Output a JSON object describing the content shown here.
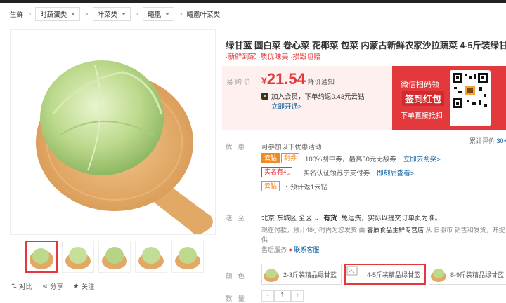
{
  "breadcrumb": {
    "items": [
      {
        "label": "生鲜",
        "type": "text"
      },
      {
        "label": "时蔬蛋类",
        "type": "select"
      },
      {
        "label": "叶菜类",
        "type": "select"
      },
      {
        "label": "曦凰",
        "type": "select"
      },
      {
        "label": "曦凰叶菜类",
        "type": "text"
      }
    ]
  },
  "image_actions": {
    "compare": "对比",
    "share": "分享",
    "follow": "关注"
  },
  "product": {
    "title": "绿甘蓝 圆白菜 卷心菜 花椰菜 包菜 内蒙古新鲜农家沙拉蔬菜 4-5斤装绿甘蓝",
    "subtitle": "·新鲜到家 ·质优味美 ·损毁包赔"
  },
  "price": {
    "label": "易购价",
    "yen": "¥",
    "value": "21.54",
    "notify": "降价通知",
    "member_text": "加入会员，下单约返0.43元云钻",
    "member_link": "立即开通>"
  },
  "promo_banner": {
    "line1": "微信扫码领",
    "line2": "签到红包",
    "line3": "下单直接抵扣"
  },
  "reviews": {
    "label": "累计评价",
    "count": "30+"
  },
  "promotions": {
    "label": "优惠",
    "intro": "可参加以下优惠活动",
    "rows": [
      {
        "tag1": "云钻",
        "tag2": "刮券",
        "text": "100%刮中券，最高50元无敌券",
        "link": "立即去刮奖>"
      },
      {
        "tag1": "实名有礼",
        "text": "实名认证领苏宁支付券",
        "link": "即刻后查看>"
      },
      {
        "tag1": "云钻",
        "text": "预计返1云钻"
      }
    ]
  },
  "shipping": {
    "label": "送至",
    "city": "北京",
    "district": "东城区",
    "area": "全区",
    "stock": "有货",
    "fee": "免运费，实际以提交订单页为准。",
    "note_prefix": "现在付款，预计48小时内为您发货",
    "note_seller_pre": "由",
    "seller": "睿辰食品生鲜专营店",
    "note_seller_post": "从 日照市 销售和发货，开提供",
    "note_service": "售后服务",
    "contact": "联系客服"
  },
  "color": {
    "label": "颜色",
    "options": [
      {
        "label": "2-3斤装精品绿甘蓝",
        "selected": false
      },
      {
        "label": "4-5斤装精品绿甘蓝",
        "selected": true
      },
      {
        "label": "8-9斤装精品绿甘蓝",
        "selected": false
      }
    ]
  },
  "quantity": {
    "label": "数量",
    "minus": "-",
    "value": "1",
    "plus": "+"
  },
  "colors": {
    "accent": "#e4393c",
    "link": "#005aa0",
    "price_bg": "#fdf0ef"
  }
}
